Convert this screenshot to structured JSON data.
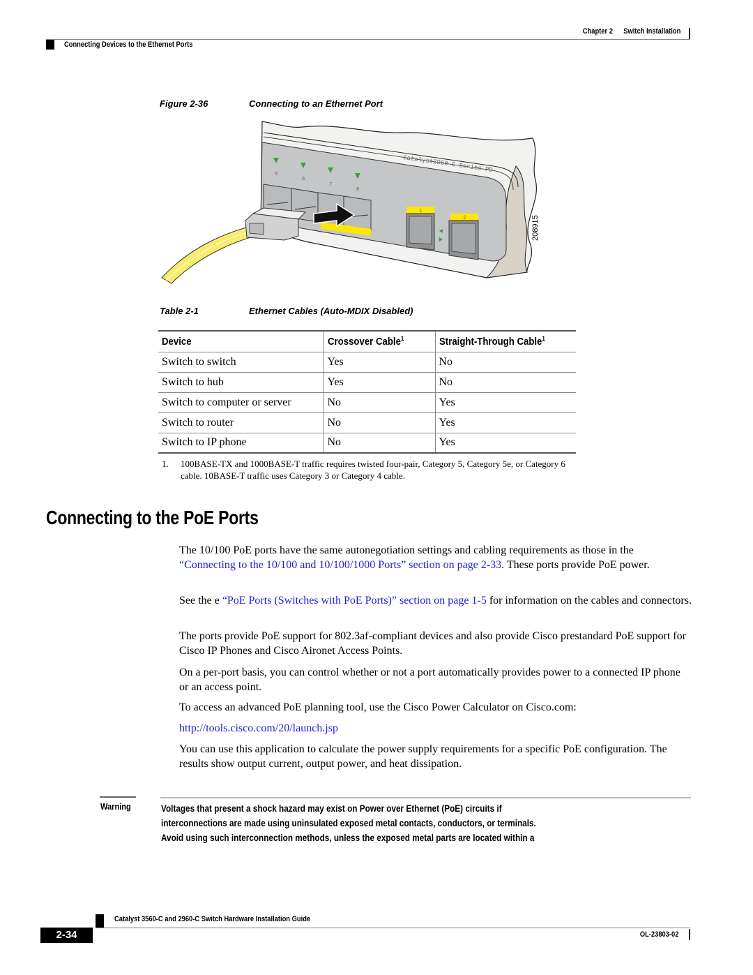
{
  "header": {
    "chapter_label": "Chapter 2",
    "chapter_title": "Switch Installation",
    "section": "Connecting Devices to the Ethernet Ports"
  },
  "figure": {
    "label": "Figure 2-36",
    "title": "Connecting to an Ethernet Port",
    "device_label": "Catalyst2960-C Series PD",
    "port_numbers": [
      "5",
      "6",
      "7",
      "8"
    ],
    "uplink_ports": [
      "1",
      "2"
    ],
    "figure_id": "208915",
    "colors": {
      "cable": "#f7ec6e",
      "port_highlight": "#ffe600",
      "led": "#3aa13a",
      "panel": "#c4c6c8",
      "bezel": "#f0f0ee"
    }
  },
  "table": {
    "label": "Table 2-1",
    "title": "Ethernet Cables (Auto-MDIX Disabled)",
    "columns": [
      {
        "label": "Device",
        "footnote": ""
      },
      {
        "label": "Crossover Cable",
        "footnote": "1"
      },
      {
        "label": "Straight-Through Cable",
        "footnote": "1"
      }
    ],
    "rows": [
      [
        "Switch to switch",
        "Yes",
        "No"
      ],
      [
        "Switch to hub",
        "Yes",
        "No"
      ],
      [
        "Switch to computer or server",
        "No",
        "Yes"
      ],
      [
        "Switch to router",
        "No",
        "Yes"
      ],
      [
        "Switch to IP phone",
        "No",
        "Yes"
      ]
    ],
    "footnote_number": "1.",
    "footnote_text": "100BASE-TX and 1000BASE-T traffic requires twisted four-pair, Category 5, Category 5e, or Category 6 cable. 10BASE-T traffic uses Category 3 or Category 4 cable."
  },
  "section": {
    "heading": "Connecting to the PoE Ports",
    "p1_before": "The 10/100 PoE ports have the same autonegotiation settings and cabling requirements as those in the ",
    "p1_link": "“Connecting to the 10/100 and 10/100/1000 Ports” section on page 2-33",
    "p1_after": ". These ports provide PoE power.",
    "p2_before": "See the e ",
    "p2_link": "“PoE Ports (Switches with PoE Ports)” section on page 1-5",
    "p2_after": " for information on the cables and connectors.",
    "p3": "The ports provide PoE support for 802.3af-compliant devices and also provide Cisco prestandard PoE support for Cisco IP Phones and Cisco Aironet Access Points.",
    "p4": "On a per-port basis, you can control whether or not a port automatically provides power to a connected IP phone or an access point.",
    "p5": "To access an advanced PoE planning tool, use the Cisco Power Calculator on Cisco.com:",
    "url": "http://tools.cisco.com/20/launch.jsp",
    "p6": "You can use this application to calculate the power supply requirements for a specific PoE configuration. The results show output current, output power, and heat dissipation."
  },
  "warning": {
    "label": "Warning",
    "lines": [
      "Voltages that present a shock hazard may exist on Power over Ethernet (PoE) circuits if",
      "interconnections are made using uninsulated exposed metal contacts, conductors, or terminals.",
      "Avoid using such interconnection methods, unless the exposed metal parts are located within a"
    ]
  },
  "footer": {
    "guide_title": "Catalyst 3560-C and 2960-C Switch Hardware Installation Guide",
    "page_number": "2-34",
    "doc_number": "OL-23803-02"
  }
}
